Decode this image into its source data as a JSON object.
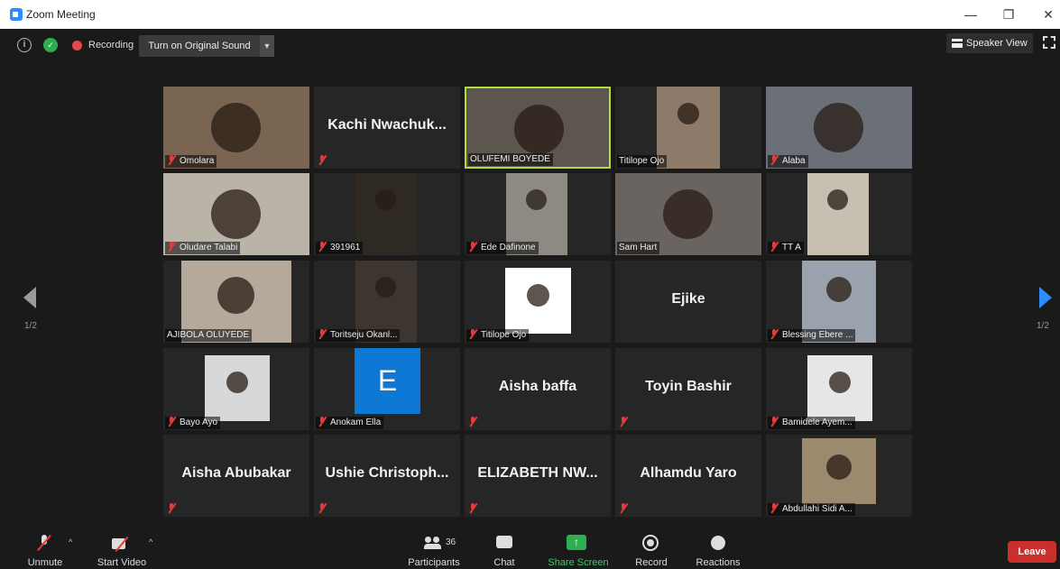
{
  "window": {
    "title": "Zoom Meeting"
  },
  "top_bar": {
    "recording_label": "Recording",
    "original_sound_label": "Turn on Original Sound",
    "speaker_view_label": "Speaker View"
  },
  "colors": {
    "active_speaker_border": "#b4db3c",
    "leave": "#c9302c",
    "share": "#2fae4f",
    "accent": "#2d8cff",
    "muted": "#e23b3b"
  },
  "pagination": {
    "left": "1/2",
    "right": "1/2"
  },
  "tiles": [
    {
      "name": "Omolara",
      "video": true,
      "muted": true,
      "bg": "#7a6552"
    },
    {
      "name": "Kachi  Nwachuk...",
      "video": false,
      "muted": true
    },
    {
      "name": "OLUFEMI BOYEDE",
      "video": true,
      "muted": false,
      "active": true,
      "bg": "#5d564f"
    },
    {
      "name": "Titilope Ojo",
      "video": true,
      "muted": false,
      "bg": "#8e7a68"
    },
    {
      "name": "Alaba",
      "video": true,
      "muted": true,
      "bg": "#6b6f78"
    },
    {
      "name": "Oludare Talabi",
      "video": true,
      "muted": true,
      "bg": "#b9b3a8"
    },
    {
      "name": "391961",
      "video": true,
      "muted": true,
      "bg": "#2f2924"
    },
    {
      "name": "Ede Dafinone",
      "video": true,
      "muted": true,
      "bg": "#8d8a84"
    },
    {
      "name": "Sam Hart",
      "video": true,
      "muted": false,
      "bg": "#6a6460"
    },
    {
      "name": "TT A",
      "video": true,
      "muted": true,
      "bg": "#c8bfb3"
    },
    {
      "name": "AJIBOLA OLUYEDE",
      "video": true,
      "muted": false,
      "bg": "#b4a99b"
    },
    {
      "name": "Toritseju Okanl...",
      "video": true,
      "muted": true,
      "bg": "#3c3530"
    },
    {
      "name": "Titilope Ojo",
      "video": true,
      "muted": true,
      "bg": "#ffffff"
    },
    {
      "name": "Ejike",
      "video": false,
      "muted": false
    },
    {
      "name": "Blessing Ebere ...",
      "video": true,
      "muted": true,
      "bg": "#9aa3ad"
    },
    {
      "name": "Bayo Ayo",
      "video": true,
      "muted": true,
      "bg": "#d8d8d8"
    },
    {
      "name": "Anokam Ella",
      "video": false,
      "muted": true,
      "avatar_letter": "E"
    },
    {
      "name": "Aisha baffa",
      "video": false,
      "muted": true
    },
    {
      "name": "Toyin Bashir",
      "video": false,
      "muted": true
    },
    {
      "name": "Bamidele Ayem...",
      "video": true,
      "muted": true,
      "bg": "#e6e6e6"
    },
    {
      "name": "Aisha Abubakar",
      "video": false,
      "muted": true
    },
    {
      "name": "Ushie  Christoph...",
      "video": false,
      "muted": true
    },
    {
      "name": "ELIZABETH  NW...",
      "video": false,
      "muted": true
    },
    {
      "name": "Alhamdu Yaro",
      "video": false,
      "muted": true
    },
    {
      "name": "Abdullahi Sidi A...",
      "video": true,
      "muted": true,
      "bg": "#9c8a6e"
    }
  ],
  "bottom_bar": {
    "unmute": "Unmute",
    "start_video": "Start Video",
    "participants": "Participants",
    "participant_count": "36",
    "chat": "Chat",
    "share_screen": "Share Screen",
    "record": "Record",
    "reactions": "Reactions",
    "leave": "Leave"
  }
}
